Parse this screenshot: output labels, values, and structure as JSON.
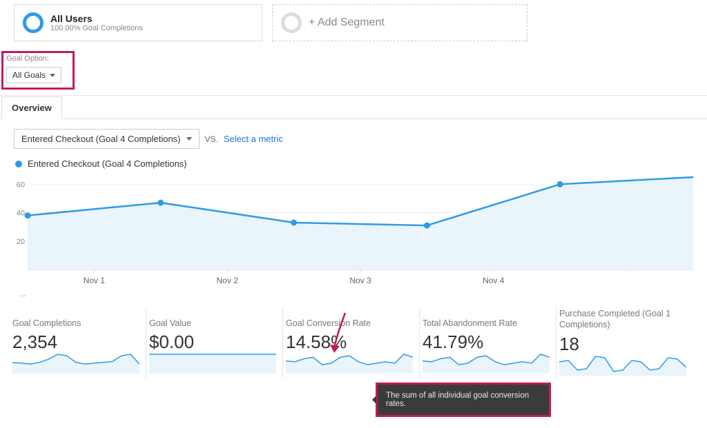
{
  "segments": {
    "primary": {
      "title": "All Users",
      "subtitle": "100.00% Goal Completions"
    },
    "add": {
      "label": "+ Add Segment"
    }
  },
  "goal_option": {
    "label": "Goal Option:",
    "selected": "All Goals"
  },
  "tabs": {
    "overview": "Overview"
  },
  "metric_selector": {
    "primary": "Entered Checkout (Goal 4 Completions)",
    "vs": "VS.",
    "secondary_link": "Select a metric"
  },
  "chart_legend": "Entered Checkout (Goal 4 Completions)",
  "chart_placeholder": "...",
  "chart_data": {
    "type": "line",
    "title": "",
    "xlabel": "",
    "ylabel": "",
    "ylim": [
      0,
      65
    ],
    "yticks": [
      20,
      40,
      60
    ],
    "categories": [
      "Nov 1",
      "Nov 2",
      "Nov 3",
      "Nov 4",
      ""
    ],
    "x_numeric": [
      0,
      1,
      2,
      3,
      4,
      5
    ],
    "values": [
      38,
      47,
      33,
      31,
      60,
      65
    ]
  },
  "metrics": [
    {
      "label": "Goal Completions",
      "value": "2,354",
      "spark": [
        12,
        11,
        10,
        12,
        16,
        22,
        20,
        12,
        10,
        11,
        12,
        13,
        20,
        22,
        10
      ]
    },
    {
      "label": "Goal Value",
      "value": "$0.00",
      "spark": [
        15,
        15,
        15,
        15,
        15,
        15,
        15,
        15,
        15,
        15,
        15,
        15,
        15,
        15,
        15
      ]
    },
    {
      "label": "Goal Conversion Rate",
      "value": "14.58%",
      "spark": [
        15,
        14,
        18,
        20,
        10,
        12,
        20,
        22,
        14,
        10,
        12,
        14,
        12,
        24,
        20
      ]
    },
    {
      "label": "Total Abandonment Rate",
      "value": "41.79%",
      "spark": [
        15,
        14,
        18,
        20,
        10,
        12,
        20,
        22,
        14,
        10,
        12,
        14,
        12,
        24,
        20
      ]
    },
    {
      "label": "Purchase Completed (Goal 1 Completions)",
      "value": "18",
      "spark": [
        18,
        20,
        6,
        8,
        26,
        24,
        4,
        6,
        20,
        18,
        6,
        8,
        24,
        22,
        10
      ]
    }
  ],
  "tooltip": "The sum of all individual goal conversion rates."
}
